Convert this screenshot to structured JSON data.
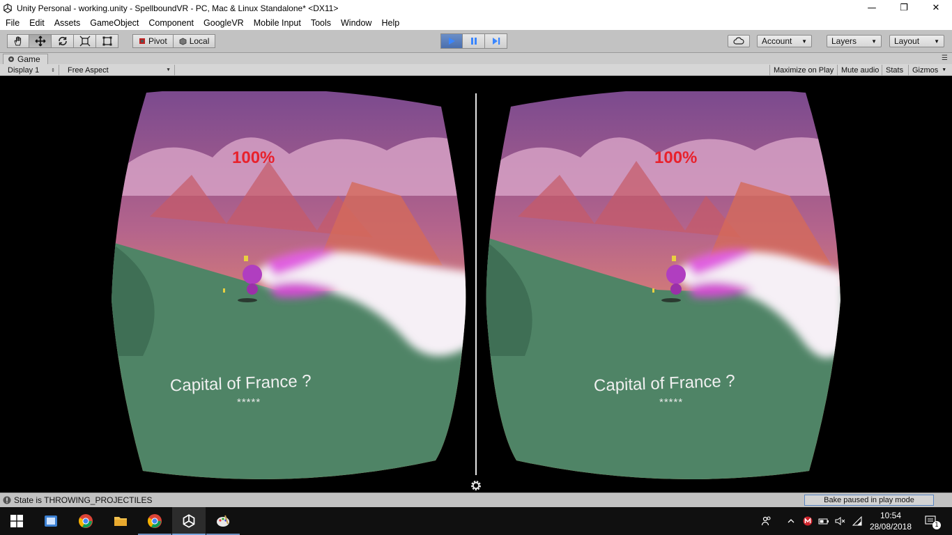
{
  "window": {
    "title": "Unity Personal - working.unity - SpellboundVR - PC, Mac & Linux Standalone* <DX11>",
    "minimize": "—",
    "maximize": "❐",
    "close": "✕"
  },
  "menu": [
    "File",
    "Edit",
    "Assets",
    "GameObject",
    "Component",
    "GoogleVR",
    "Mobile Input",
    "Tools",
    "Window",
    "Help"
  ],
  "toolbar": {
    "pivot_label": "Pivot",
    "local_label": "Local",
    "account_label": "Account",
    "layers_label": "Layers",
    "layout_label": "Layout"
  },
  "game_panel": {
    "tab_label": "Game",
    "display": "Display 1",
    "aspect": "Free Aspect",
    "maximize_on_play": "Maximize on Play",
    "mute_audio": "Mute audio",
    "stats": "Stats",
    "gizmos": "Gizmos"
  },
  "hud": {
    "percent": "100%",
    "question": "Capital of France ?",
    "answer_mask": "*****"
  },
  "status": {
    "message": "State is THROWING_PROJECTILES",
    "bake": "Bake paused in play mode"
  },
  "taskbar": {
    "time": "10:54",
    "date": "28/08/2018",
    "notifications": "1"
  },
  "colors": {
    "toolbar_bg": "#c2c2c2",
    "play_active": "#4a6fae",
    "hud_red": "#e8212c"
  }
}
